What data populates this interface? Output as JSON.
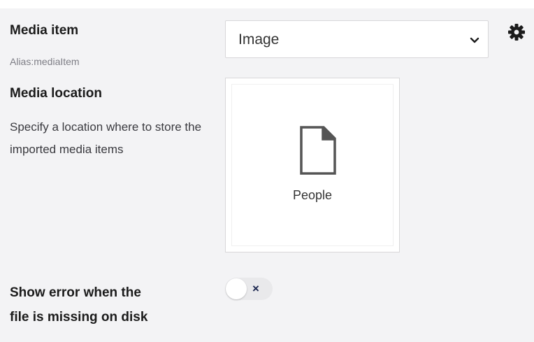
{
  "fields": {
    "media_item": {
      "label": "Media item",
      "alias": "Alias:mediaItem",
      "selected": "Image",
      "icon": "gear-icon"
    },
    "media_location": {
      "label": "Media location",
      "description": "Specify a location where to store the imported media items",
      "selected_node": "People",
      "node_icon": "document-icon"
    },
    "show_error": {
      "label_line1": "Show error when the",
      "label_line2": "file is missing on disk",
      "toggle_state": "off",
      "toggle_symbol": "×"
    }
  },
  "colors": {
    "panel_bg": "#f3f3f5",
    "label_text": "#1b1b1b",
    "alias_text": "#7d7d85",
    "border": "#d8d7d9",
    "toggle_off_bg": "#e9e9eb"
  }
}
